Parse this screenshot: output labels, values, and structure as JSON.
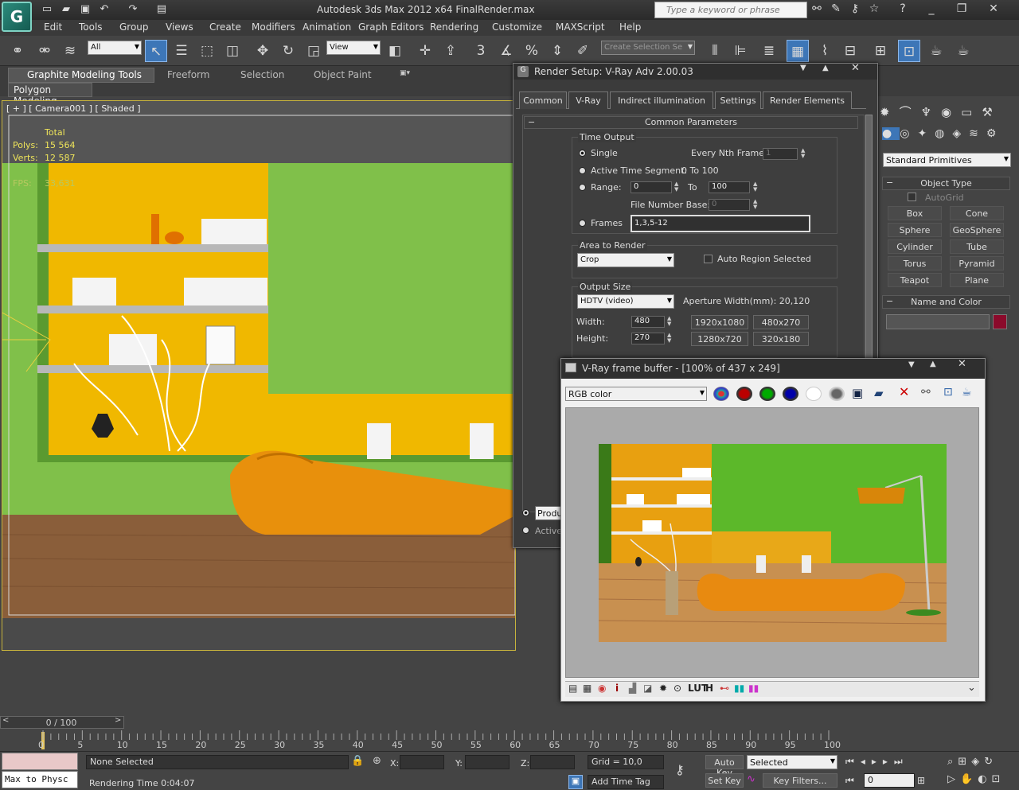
{
  "app": {
    "title": "Autodesk 3ds Max  2012 x64        FinalRender.max",
    "search_placeholder": "Type a keyword or phrase",
    "logo": "3ds-max-logo"
  },
  "menu": [
    "Edit",
    "Tools",
    "Group",
    "Views",
    "Create",
    "Modifiers",
    "Animation",
    "Graph Editors",
    "Rendering",
    "Customize",
    "MAXScript",
    "Help"
  ],
  "toolbar": {
    "selection_filter": "All",
    "ref_coord": "View",
    "named_selection": "Create Selection Se"
  },
  "ribbon": {
    "tabs": [
      "Graphite Modeling Tools",
      "Freeform",
      "Selection",
      "Object Paint"
    ],
    "subtab": "Polygon Modeling"
  },
  "viewport": {
    "label": "[ + ] [ Camera001 ] [ Shaded ]",
    "stats_header": "Total",
    "polys_label": "Polys:",
    "polys_value": "15 564",
    "verts_label": "Verts:",
    "verts_value": "12 587",
    "fps_label": "FPS:",
    "fps_value": "33,631"
  },
  "render_setup": {
    "title": "Render Setup: V-Ray Adv 2.00.03",
    "tabs": [
      "Common",
      "V-Ray",
      "Indirect illumination",
      "Settings",
      "Render Elements"
    ],
    "rollout": "Common Parameters",
    "time_output": {
      "group": "Time Output",
      "single": "Single",
      "every_nth": "Every Nth Frame:",
      "every_nth_value": "1",
      "active_segment": "Active Time Segment:",
      "segment_value": "0 To 100",
      "range": "Range:",
      "range_from": "0",
      "range_to_label": "To",
      "range_to": "100",
      "file_base": "File Number Base:",
      "file_base_value": "0",
      "frames": "Frames",
      "frames_value": "1,3,5-12"
    },
    "area": {
      "group": "Area to Render",
      "value": "Crop",
      "auto_region": "Auto Region Selected"
    },
    "output_size": {
      "group": "Output Size",
      "preset": "HDTV (video)",
      "aperture": "Aperture Width(mm): 20,120",
      "width_label": "Width:",
      "width": "480",
      "height_label": "Height:",
      "height": "270",
      "presets": [
        "1920x1080",
        "480x270",
        "1280x720",
        "320x180"
      ]
    },
    "bottom": {
      "production": "Produ",
      "active": "Active"
    }
  },
  "vfb": {
    "title": "V-Ray frame buffer - [100% of 437 x 249]",
    "channel": "RGB color",
    "bottom_text": [
      "i",
      "LUT",
      "H"
    ]
  },
  "command_panel": {
    "category": "Standard Primitives",
    "object_type": "Object Type",
    "autogrid": "AutoGrid",
    "primitives": [
      "Box",
      "Cone",
      "Sphere",
      "GeoSphere",
      "Cylinder",
      "Tube",
      "Torus",
      "Pyramid",
      "Teapot",
      "Plane"
    ],
    "name_color": "Name and Color",
    "color": "#8b0a2b"
  },
  "timeline": {
    "position": "0 / 100",
    "ticks": [
      "0",
      "5",
      "10",
      "15",
      "20",
      "25",
      "30",
      "35",
      "40",
      "45",
      "50",
      "55",
      "60",
      "65",
      "70",
      "75",
      "80",
      "85",
      "90",
      "95",
      "100"
    ]
  },
  "status": {
    "maxscript": "Max to Physc",
    "selection": "None Selected",
    "rendering_time": "Rendering Time  0:04:07",
    "x_label": "X:",
    "y_label": "Y:",
    "z_label": "Z:",
    "grid": "Grid = 10,0",
    "add_time_tag": "Add Time Tag",
    "auto_key": "Auto Key",
    "set_key": "Set Key",
    "key_mode": "Selected",
    "key_filters": "Key Filters...",
    "frame": "0"
  }
}
